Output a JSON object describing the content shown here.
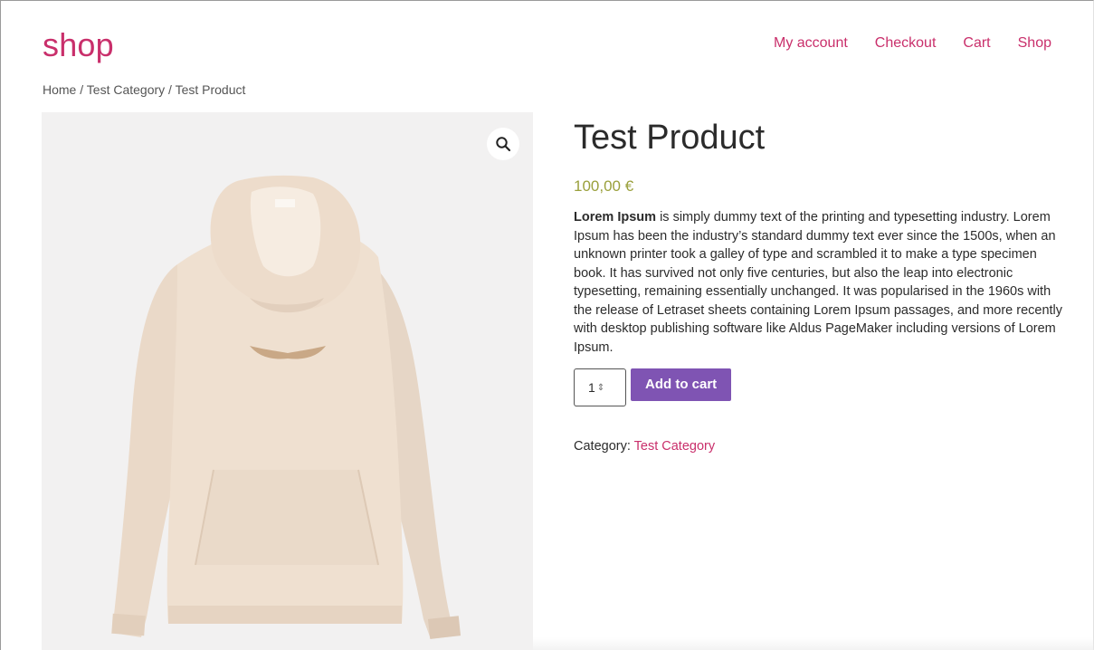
{
  "site": {
    "title": "shop"
  },
  "nav": {
    "items": [
      {
        "label": "My account"
      },
      {
        "label": "Checkout"
      },
      {
        "label": "Cart"
      },
      {
        "label": "Shop"
      }
    ]
  },
  "breadcrumb": {
    "home": "Home",
    "category": "Test Category",
    "current": "Test Product",
    "separator": " / "
  },
  "product": {
    "title": "Test Product",
    "price": "100,00 €",
    "description_bold": "Lorem Ipsum",
    "description_rest": " is simply dummy text of the printing and typesetting industry. Lorem Ipsum has been the industry’s standard dummy text ever since the 1500s, when an unknown printer took a galley of type and scrambled it to make a type specimen book. It has survived not only five centuries, but also the leap into electronic typesetting, remaining essentially unchanged. It was popularised in the 1960s with the release of Letraset sheets containing Lorem Ipsum passages, and more recently with desktop publishing software like Aldus PageMaker including versions of Lorem Ipsum.",
    "quantity": "1",
    "add_to_cart": "Add to cart",
    "category_label": "Category: ",
    "category_value": "Test Category"
  },
  "gallery": {
    "zoom_icon": "search-icon"
  },
  "colors": {
    "brand": "#c92f6b",
    "price": "#9aa03c",
    "button": "#7f54b3",
    "image_bg": "#f2f1f1"
  }
}
